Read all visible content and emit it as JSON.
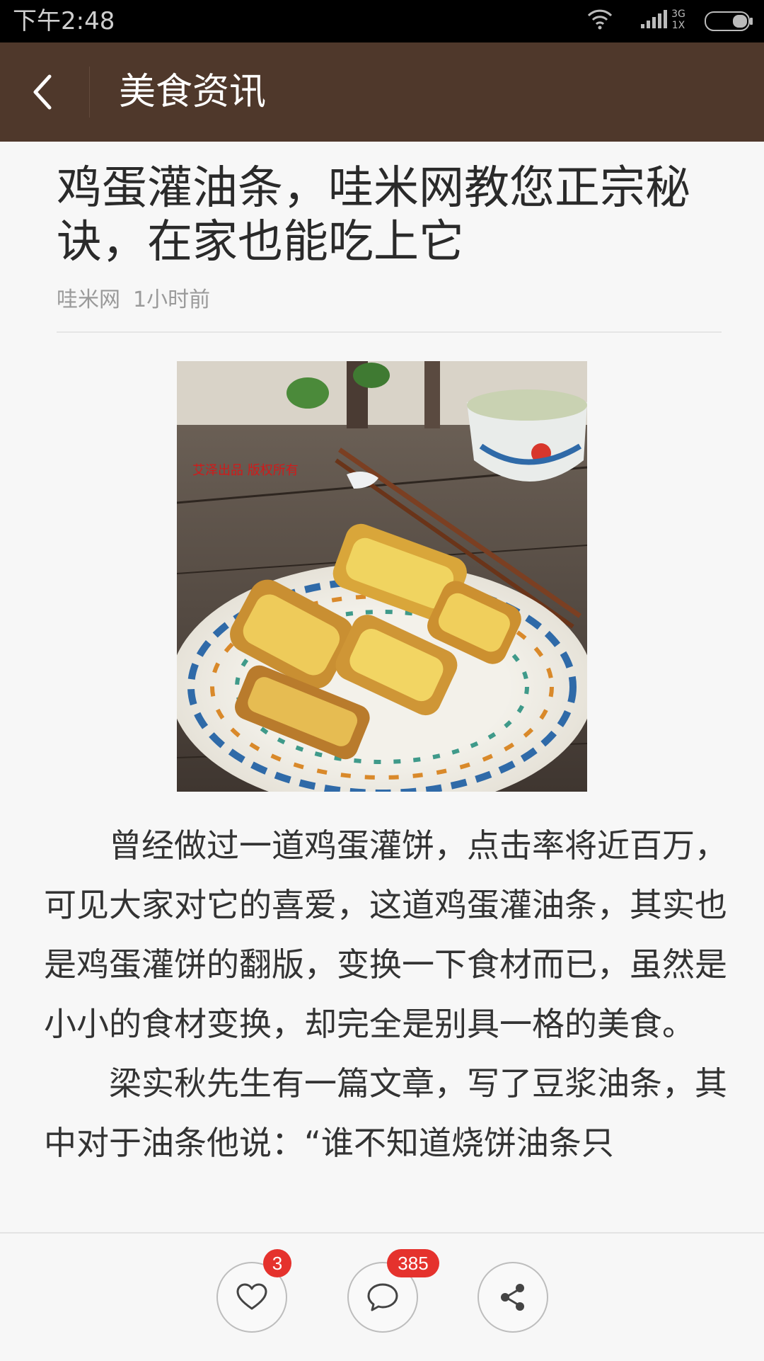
{
  "status_bar": {
    "time": "下午2:48",
    "network": "3G 1X",
    "icons": [
      "wifi-icon",
      "signal-icon",
      "battery-icon"
    ]
  },
  "header": {
    "title": "美食资讯",
    "back_icon": "chevron-left-icon"
  },
  "article": {
    "title": "鸡蛋灌油条，哇米网教您正宗秘诀，在家也能吃上它",
    "source": "哇米网",
    "time": "1小时前",
    "image_watermark": "艾泽出品 版权所有",
    "paragraphs": [
      "曾经做过一道鸡蛋灌饼，点击率将近百万，可见大家对它的喜爱，这道鸡蛋灌油条，其实也是鸡蛋灌饼的翻版，变换一下食材而已，虽然是小小的食材变换，却完全是别具一格的美食。",
      "梁实秋先生有一篇文章，写了豆浆油条，其中对于油条他说：“谁不知道烧饼油条只"
    ]
  },
  "actions": {
    "like_count": "3",
    "comment_count": "385",
    "icons": [
      "heart-icon",
      "comment-icon",
      "share-icon"
    ]
  },
  "colors": {
    "header_bg": "#4f382b",
    "badge": "#e5322d",
    "background": "#f7f7f7"
  }
}
